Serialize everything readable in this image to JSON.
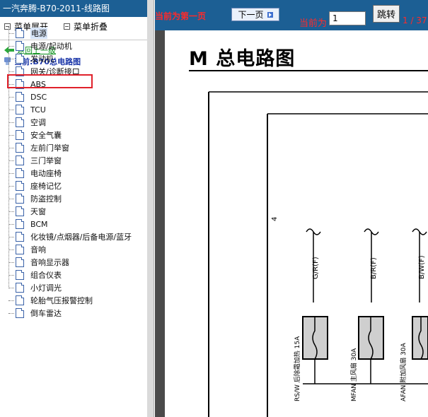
{
  "sidebar": {
    "header_title": "一汽奔腾-B70-2011-线路图",
    "expand_label": "菜单展开",
    "collapse_label": "菜单折叠",
    "back_label": "返回上一级",
    "current_label": "当前:B70总电路图",
    "items": [
      "电源",
      "电源/起动机",
      "发动机",
      "网关/诊断接口",
      "ABS",
      "DSC",
      "TCU",
      "空调",
      "安全气囊",
      "左前门举窗",
      "三门举窗",
      "电动座椅",
      "座椅记忆",
      "防盗控制",
      "天窗",
      "BCM",
      "化妆镜/点烟器/后备电源/蓝牙",
      "音响",
      "音响显示器",
      "组合仪表",
      "小灯调光",
      "轮胎气压报警控制",
      "倒车雷达"
    ],
    "selected_index": 0
  },
  "toolbar": {
    "first_page_text": "当前为第一页",
    "next_label": "下一页",
    "current_label": "当前为",
    "page_value": "1",
    "jump_label": "跳转",
    "page_info": "1 / 37"
  },
  "document": {
    "title": "M 总电路图",
    "side_number": "4",
    "wire_labels": [
      "G/R(F)",
      "B/R(F)",
      "B/W(F)"
    ],
    "fuse_labels": [
      "RS/W 后除霜加热 15A",
      "MFAN 主风扇 30A",
      "AFAN 附加风扇 30A"
    ]
  },
  "colors": {
    "header_blue": "#1c5f94",
    "highlight_red": "#e0212b",
    "link_green": "#0a8f1a",
    "current_blue": "#1a35a8"
  }
}
